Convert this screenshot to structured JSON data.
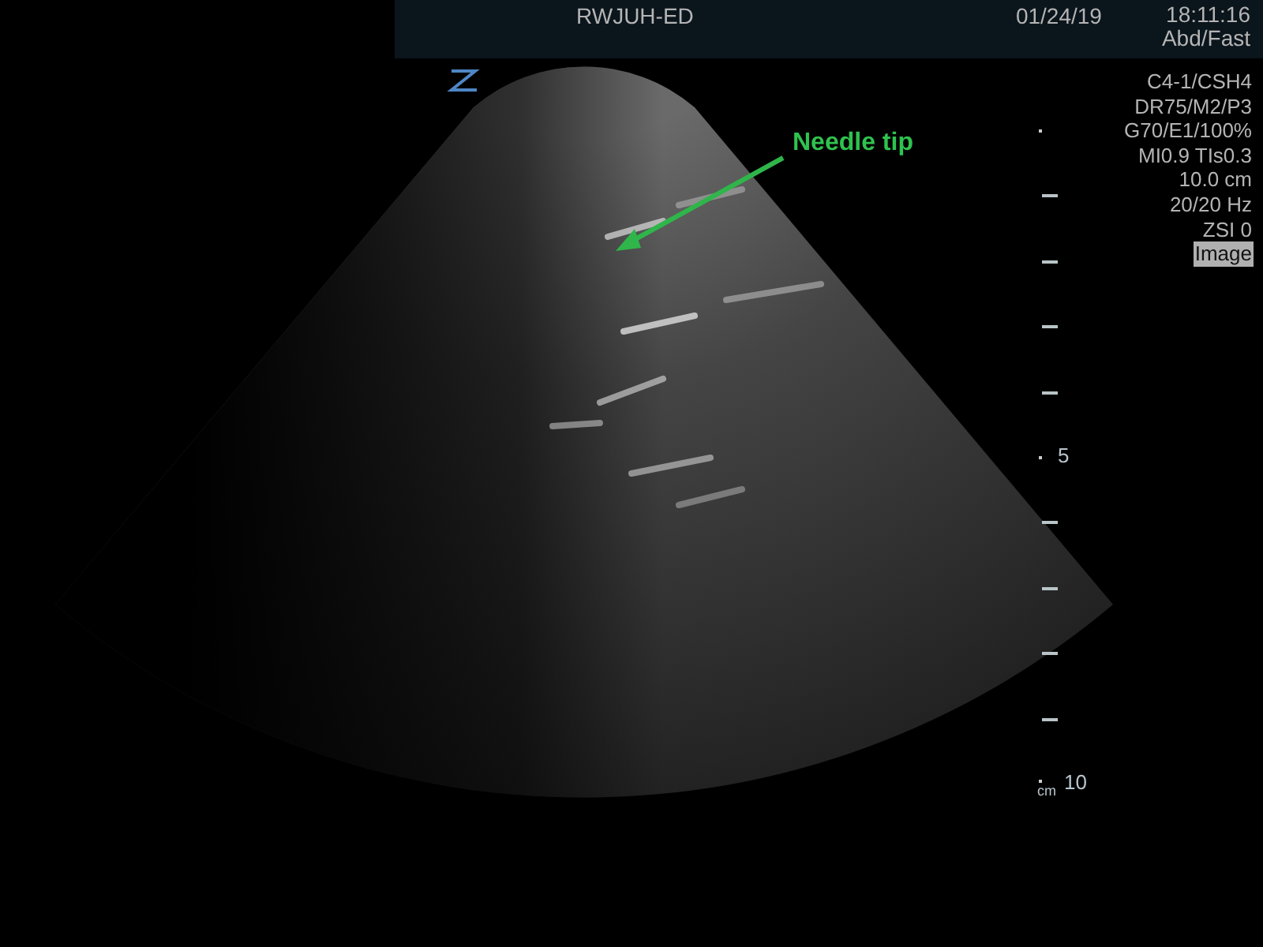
{
  "header": {
    "site": "RWJUH-ED",
    "date": "01/24/19",
    "time": "18:11:16",
    "preset": "Abd/Fast"
  },
  "parameters": [
    {
      "text": "C4-1/CSH4",
      "highlighted": false
    },
    {
      "text": "DR75/M2/P3",
      "highlighted": false
    },
    {
      "text": "G70/E1/100%",
      "highlighted": false
    },
    {
      "text": "MI0.9  TIs0.3",
      "highlighted": false
    },
    {
      "text": "10.0 cm",
      "highlighted": false
    },
    {
      "text": "20/20 Hz",
      "highlighted": false
    },
    {
      "text": "ZSI 0",
      "highlighted": false
    },
    {
      "text": "Image",
      "highlighted": true
    }
  ],
  "annotation": {
    "text": "Needle tip"
  },
  "depth_scale": {
    "mid_label": "5",
    "end_label": "10",
    "unit": "cm"
  }
}
